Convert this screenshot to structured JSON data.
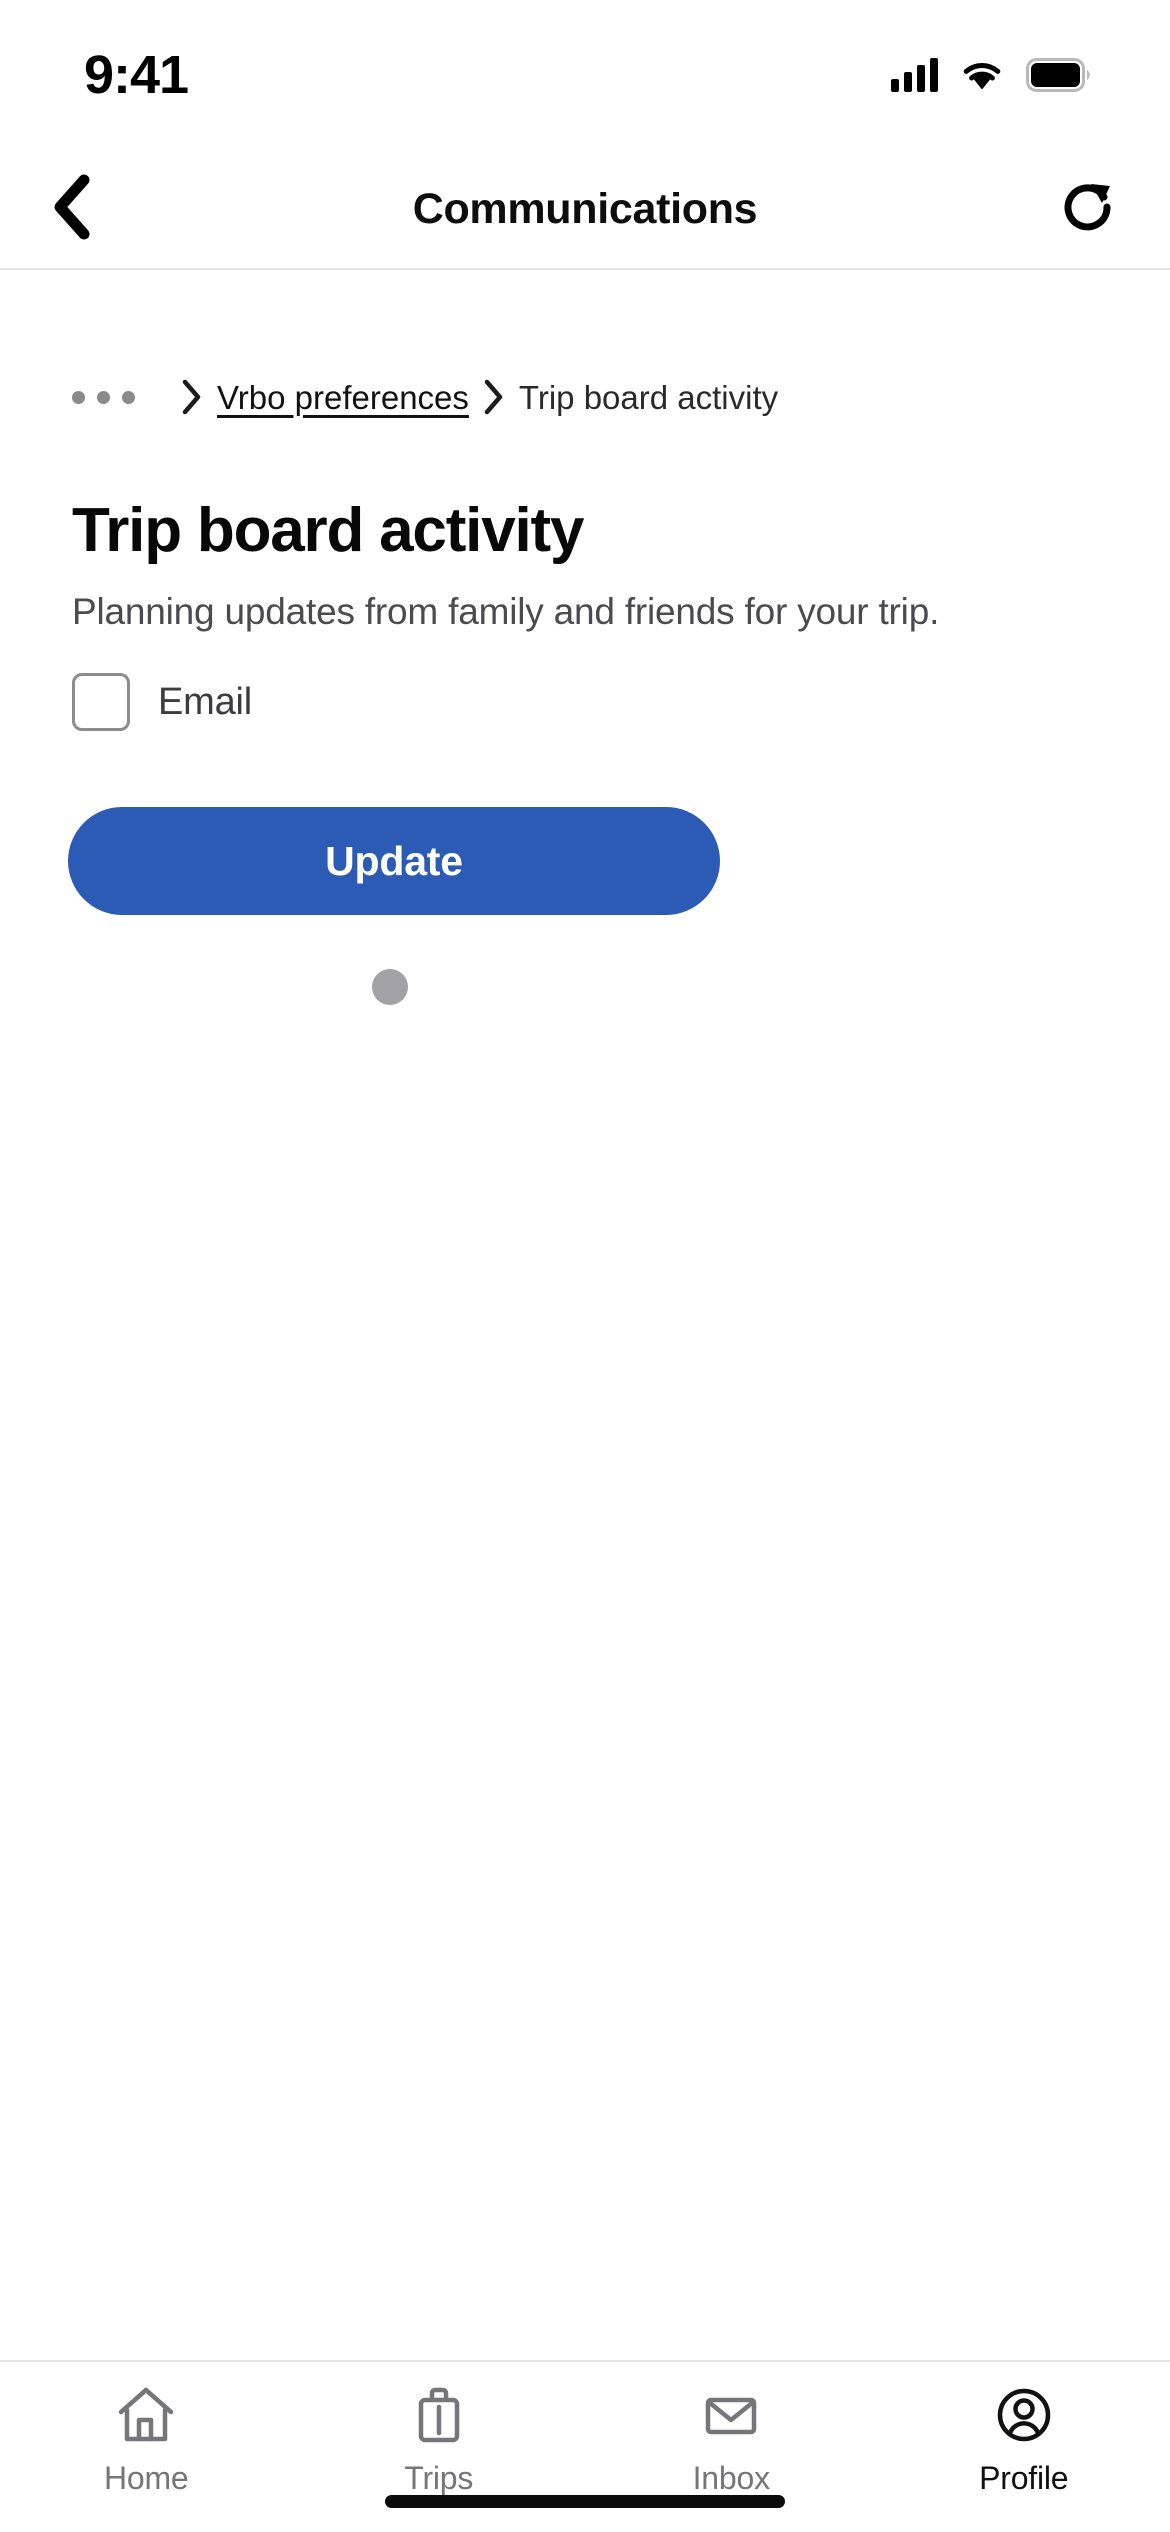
{
  "status_bar": {
    "time": "9:41",
    "cellular_icon": "signal-bars-icon",
    "wifi_icon": "wifi-icon",
    "battery_icon": "battery-full-icon"
  },
  "nav_bar": {
    "back_icon": "chevron-left-icon",
    "title": "Communications",
    "refresh_icon": "refresh-icon"
  },
  "breadcrumb": {
    "overflow_label": "•••",
    "overflow_icon": "ellipsis-icon",
    "separator_icon": "chevron-right-icon",
    "items": [
      {
        "label": "Vrbo preferences",
        "is_link": true
      },
      {
        "label": "Trip board activity",
        "is_link": false
      }
    ]
  },
  "main": {
    "title": "Trip board activity",
    "description": "Planning updates from family and friends for your trip.",
    "checkbox": {
      "label": "Email",
      "checked": false
    },
    "update_label": "Update",
    "loading_indicator": "loading-dot"
  },
  "tab_bar": {
    "tabs": [
      {
        "label": "Home",
        "icon": "home-icon",
        "active": false
      },
      {
        "label": "Trips",
        "icon": "suitcase-icon",
        "active": false
      },
      {
        "label": "Inbox",
        "icon": "envelope-icon",
        "active": false
      },
      {
        "label": "Profile",
        "icon": "person-circle-icon",
        "active": true
      }
    ]
  },
  "colors": {
    "accent_blue": "#2b5bb5",
    "inactive_gray": "#76767a",
    "active_black": "#111114",
    "loading_dot_gray": "#a2a2a6"
  }
}
